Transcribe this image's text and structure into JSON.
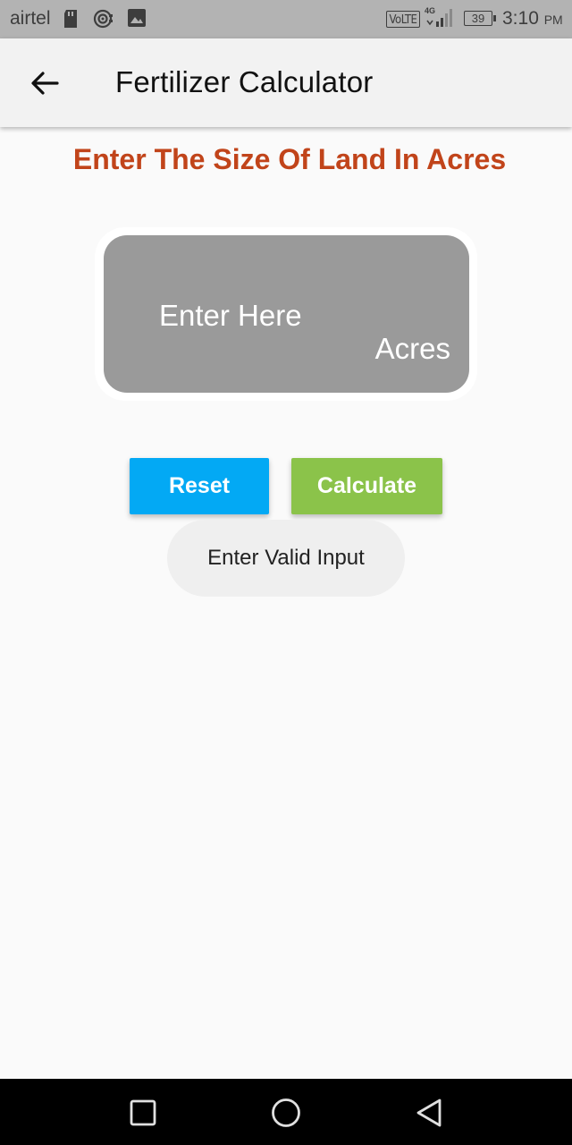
{
  "status_bar": {
    "carrier": "airtel",
    "network_type": "VoLTE",
    "data_type": "4G",
    "battery_level": "39",
    "time": "3:10",
    "ampm": "PM",
    "icons": [
      "sd-card-icon",
      "hotspot-icon",
      "image-icon",
      "signal-icon",
      "battery-icon"
    ]
  },
  "app_bar": {
    "title": "Fertilizer Calculator",
    "back_icon": "arrow-left-icon"
  },
  "main": {
    "heading": "Enter The Size Of Land In Acres",
    "heading_color": "#c1441a",
    "land_input": {
      "placeholder": "Enter Here",
      "value": "",
      "suffix": "Acres"
    },
    "buttons": {
      "reset_label": "Reset",
      "reset_color": "#03a9f4",
      "calculate_label": "Calculate",
      "calculate_color": "#8bc34a"
    },
    "toast_message": "Enter Valid Input"
  },
  "nav_bar": {
    "buttons": [
      "recents-square-icon",
      "home-circle-icon",
      "back-triangle-icon"
    ]
  }
}
